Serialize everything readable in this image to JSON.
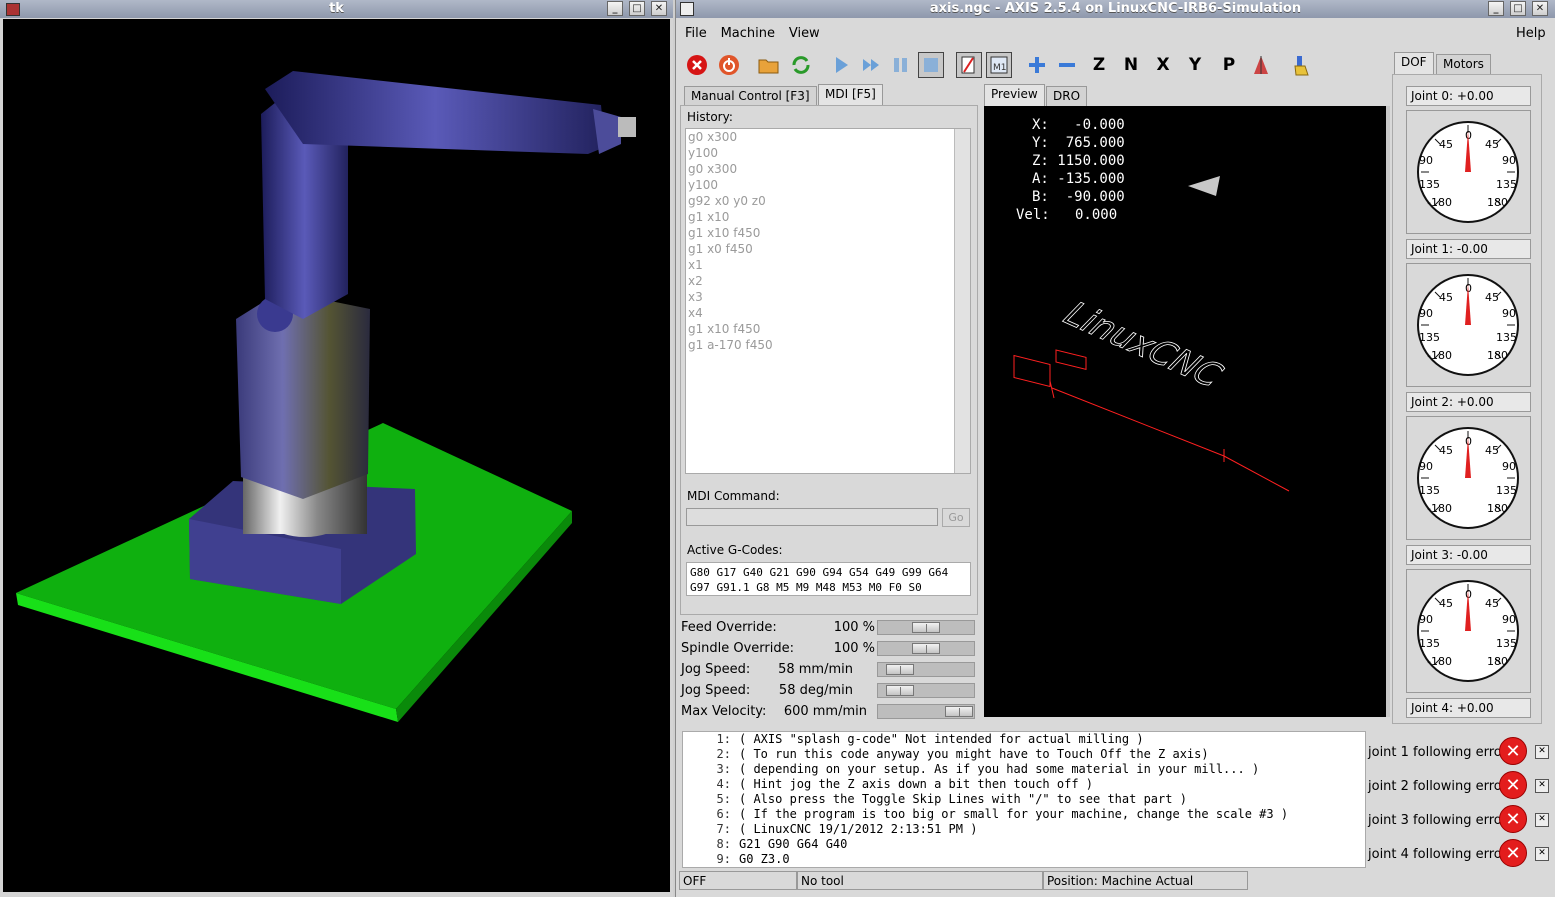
{
  "tk_window": {
    "title": "tk"
  },
  "axis_window": {
    "title": "axis.ngc - AXIS 2.5.4 on LinuxCNC-IRB6-Simulation"
  },
  "menu": {
    "file": "File",
    "machine": "Machine",
    "view": "View",
    "help": "Help"
  },
  "left_tabs": {
    "manual": "Manual Control [F3]",
    "mdi": "MDI [F5]"
  },
  "history": {
    "label": "History:",
    "items": [
      "g0 x300",
      "y100",
      "g0 x300",
      "y100",
      "g92 x0 y0 z0",
      "g1 x10",
      "g1 x10 f450",
      "g1 x0 f450",
      "x1",
      "x2",
      "x3",
      "x4",
      "g1 x10 f450",
      "g1 a-170 f450"
    ]
  },
  "mdi": {
    "label": "MDI Command:",
    "value": "",
    "go": "Go"
  },
  "gcodes": {
    "label": "Active G-Codes:",
    "line1": "G80 G17 G40 G21 G90 G94 G54 G49 G99 G64",
    "line2": "G97 G91.1 G8 M5 M9 M48 M53 M0 F0 S0"
  },
  "overrides": {
    "feed": {
      "label": "Feed Override:",
      "value": "100 %",
      "level": 0.5
    },
    "spindle": {
      "label": "Spindle Override:",
      "value": "100 %",
      "level": 0.5
    },
    "jog_lin": {
      "label": "Jog Speed:",
      "value": "58 mm/min",
      "level": 0.1
    },
    "jog_ang": {
      "label": "Jog Speed:",
      "value": "58 deg/min",
      "level": 0.1
    },
    "maxvel": {
      "label": "Max Velocity:",
      "value": "600 mm/min",
      "level": 1.0
    }
  },
  "view_tabs": {
    "preview": "Preview",
    "dro": "DRO"
  },
  "dro": {
    "x": "X:   -0.000",
    "y": "Y:  765.000",
    "z": "Z: 1150.000",
    "a": "A: -135.000",
    "b": "B:  -90.000",
    "vel": "Vel:   0.000"
  },
  "right_tabs": {
    "dof": "DOF",
    "motors": "Motors"
  },
  "joints": [
    {
      "label": "Joint 0:  +0.00"
    },
    {
      "label": "Joint 1:  -0.00"
    },
    {
      "label": "Joint 2:  +0.00"
    },
    {
      "label": "Joint 3:  -0.00"
    },
    {
      "label": "Joint 4:  +0.00"
    }
  ],
  "gauge_ticks": {
    "t0": "0",
    "t45a": "45",
    "t45b": "45",
    "t90a": "90",
    "t90b": "90",
    "t135a": "135",
    "t135b": "135",
    "t180a": "-180",
    "t180b": "180"
  },
  "code": [
    {
      "n": "1:",
      "t": "( AXIS \"splash g-code\" Not intended for actual milling )"
    },
    {
      "n": "2:",
      "t": "( To run this code anyway you might have to Touch Off the Z axis)"
    },
    {
      "n": "3:",
      "t": "( depending on your setup. As if you had some material in your mill... )"
    },
    {
      "n": "4:",
      "t": "( Hint jog the Z axis down a bit then touch off )"
    },
    {
      "n": "5:",
      "t": "( Also press the Toggle Skip Lines with \"/\" to see that part )"
    },
    {
      "n": "6:",
      "t": "( If the program is too big or small for your machine, change the scale #3 )"
    },
    {
      "n": "7:",
      "t": "( LinuxCNC 19/1/2012 2:13:51 PM )"
    },
    {
      "n": "8:",
      "t": "G21 G90 G64 G40"
    },
    {
      "n": "9:",
      "t": "G0 Z3.0"
    }
  ],
  "errors": [
    {
      "text": "joint 1 following error"
    },
    {
      "text": "joint 2 following error"
    },
    {
      "text": "joint 3 following error"
    },
    {
      "text": "joint 4 following error"
    }
  ],
  "status": {
    "state": "OFF",
    "tool": "No tool",
    "position": "Position: Machine Actual"
  },
  "preview_text": "LinuxCNC",
  "colors": {
    "floor": "#0fb00f",
    "robot": "#3a3a9a",
    "toolpath": "#ff2020"
  }
}
